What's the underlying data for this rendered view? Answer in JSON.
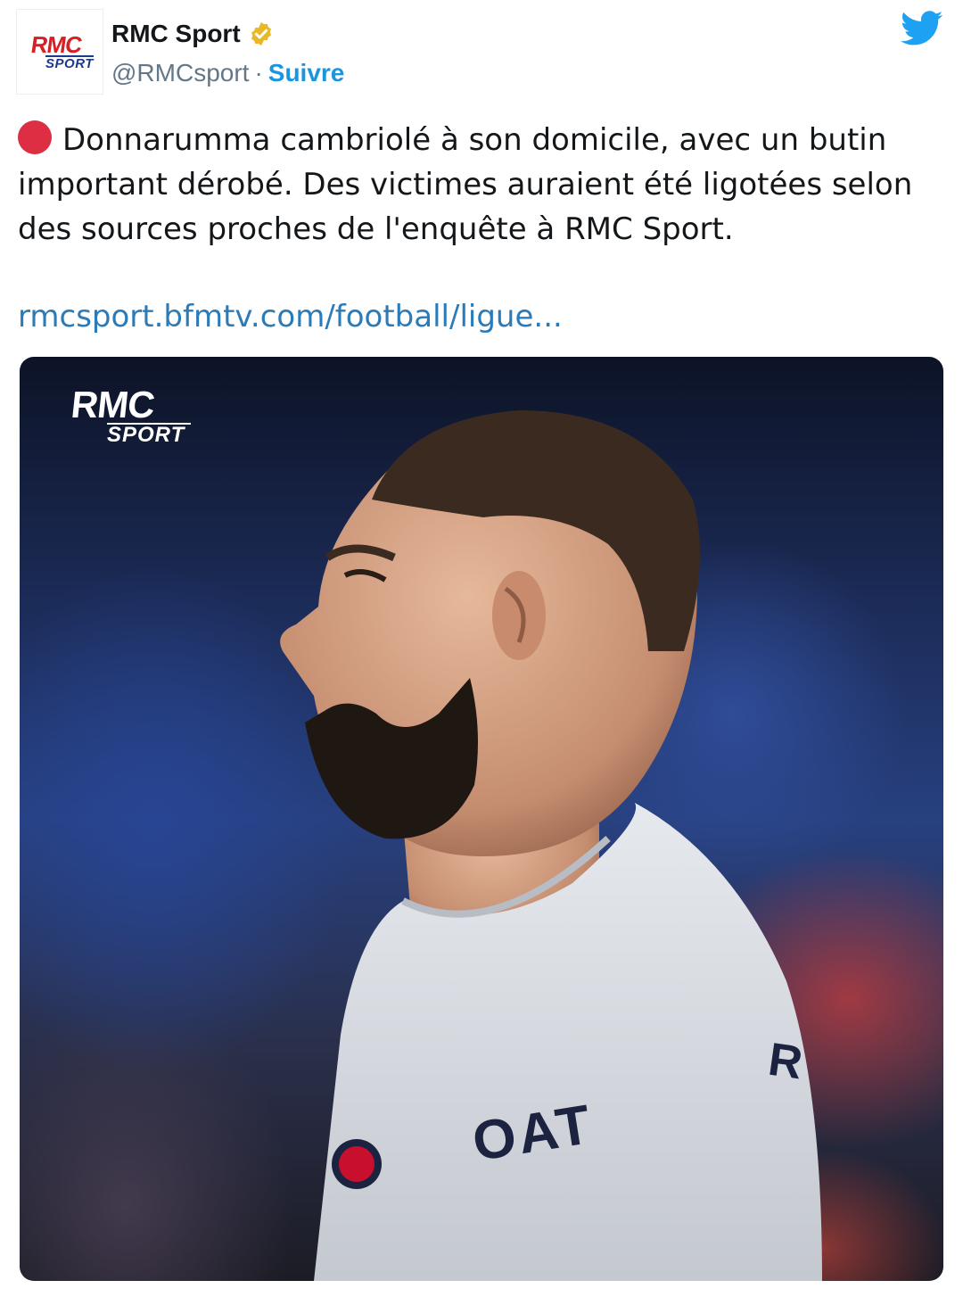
{
  "header": {
    "avatar": {
      "logo_top": "RMC",
      "logo_bottom": "SPORT"
    },
    "account_name": "RMC Sport",
    "handle": "@RMCsport",
    "separator": "·",
    "follow_label": "Suivre",
    "verified_icon": "verified-badge-icon",
    "platform_icon": "twitter-bird-icon"
  },
  "tweet": {
    "emoji": "red-circle-icon",
    "text": "Donnarumma cambriolé à son domicile, avec un butin important dérobé. Des victimes auraient été ligotées selon des sources proches de l'enquête à RMC Sport.",
    "link": "rmcsport.bfmtv.com/football/ligue..."
  },
  "media": {
    "watermark_top": "RMC",
    "watermark_bottom": "SPORT",
    "jersey_text": "OAT",
    "jersey_text_2": "R"
  },
  "colors": {
    "link": "#2b7bb9",
    "follow": "#1b95e0",
    "twitter_blue": "#1da1f2",
    "verified_gold": "#e8b827",
    "red_circle": "#dd2e44"
  }
}
